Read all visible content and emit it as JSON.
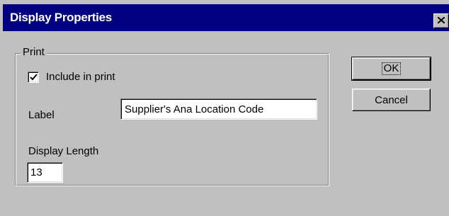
{
  "window": {
    "title": "Display Properties",
    "close_icon": "close-x-icon"
  },
  "print_group": {
    "legend": "Print",
    "include_checkbox": {
      "label": "Include in print",
      "checked": true
    },
    "label_field": {
      "label": "Label",
      "value": "Supplier's Ana Location Code"
    },
    "display_length": {
      "label": "Display Length",
      "value": "13"
    }
  },
  "buttons": {
    "ok": "OK",
    "cancel": "Cancel"
  },
  "colors": {
    "titlebar": "#000080",
    "face": "#c0c0c0"
  }
}
